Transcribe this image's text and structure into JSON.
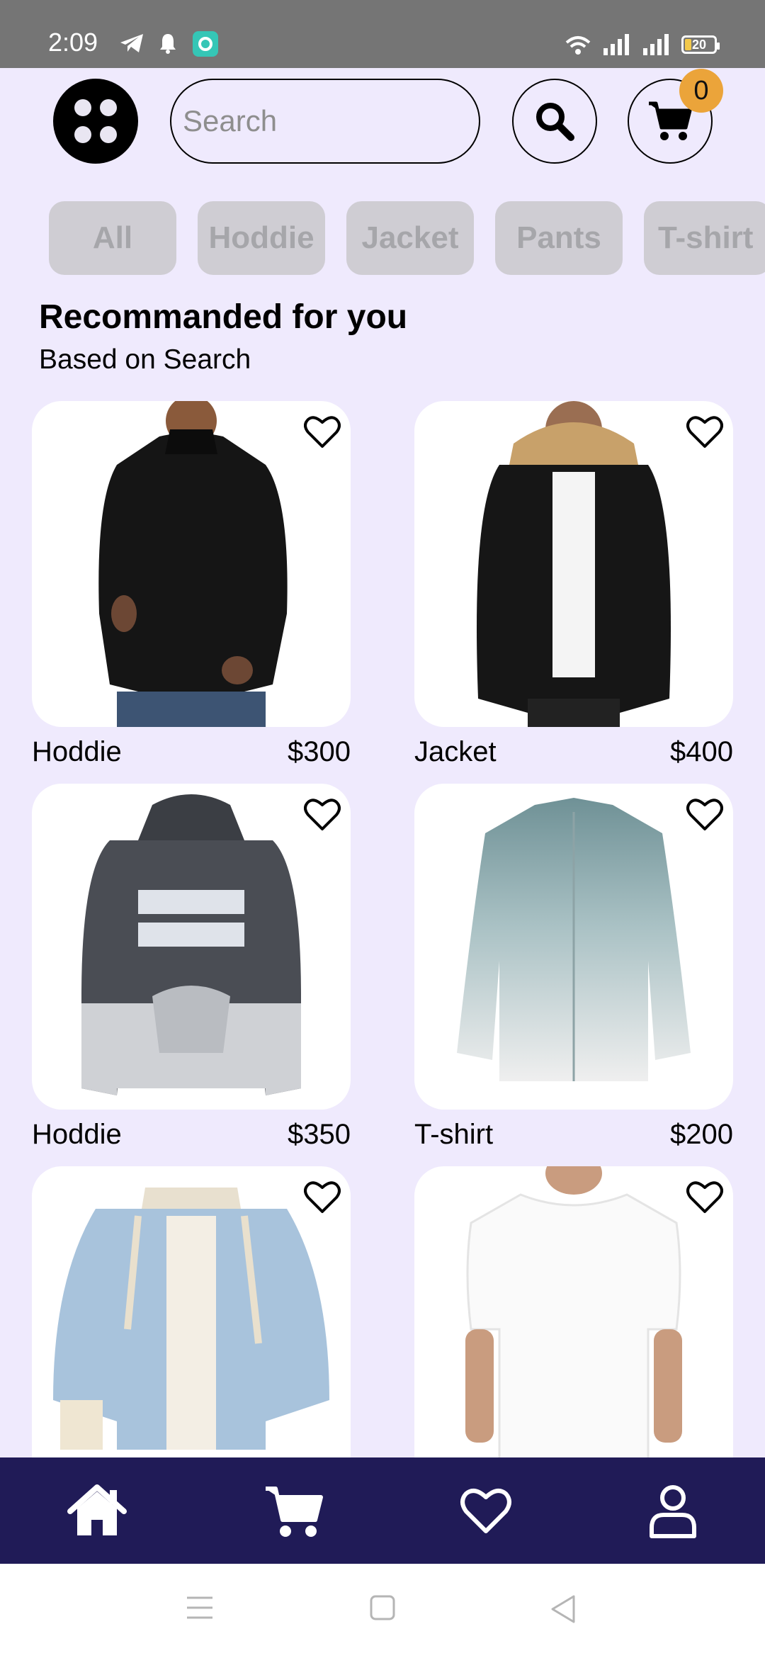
{
  "status_bar": {
    "time": "2:09",
    "battery": "20"
  },
  "header": {
    "menu_icon": "menu-dots-icon",
    "search_placeholder": "Search",
    "search_icon": "search-icon",
    "cart_icon": "cart-icon",
    "cart_count": "0"
  },
  "categories": [
    "All",
    "Hoddie",
    "Jacket",
    "Pants",
    "T-shirt"
  ],
  "section": {
    "title": "Recommanded for you",
    "subtitle": "Based on Search"
  },
  "products": [
    {
      "name": "Hoddie",
      "price": "$300"
    },
    {
      "name": "Jacket",
      "price": "$400"
    },
    {
      "name": "Hoddie",
      "price": "$350"
    },
    {
      "name": "T-shirt",
      "price": "$200"
    },
    {
      "name": "",
      "price": ""
    },
    {
      "name": "",
      "price": ""
    }
  ],
  "bottom_nav": [
    "home-icon",
    "cart-icon",
    "heart-icon",
    "profile-icon"
  ],
  "colors": {
    "background": "#efeafd",
    "nav": "#201b57",
    "badge": "#eba43a",
    "chip": "#cfcdd3"
  }
}
